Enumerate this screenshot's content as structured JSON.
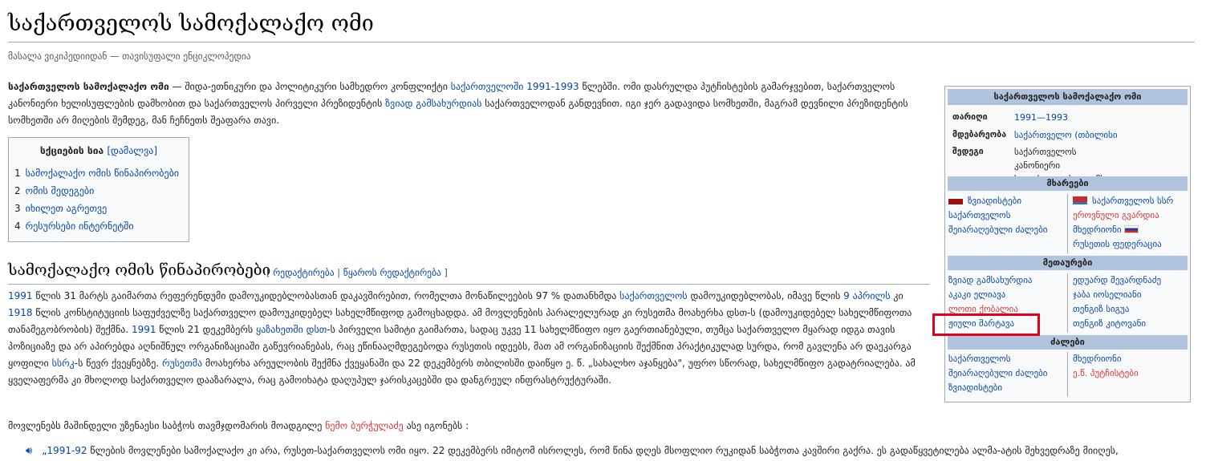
{
  "title": "საქართველოს სამოქალაქო ომი",
  "tagline": "მასალა ვიკიპედიიდან — თავისუფალი ენციკლოპედია",
  "intro": {
    "bold": "საქართველოს სამოქალაქო ომი",
    "t1": " — შიდა-ეთნიკური და პოლიტიკური სამხედრო კონფლიქტი ",
    "link1": "საქართველოში",
    "t2": " ",
    "link2": "1991-1993",
    "t3": " წლებში. ომი დასრულდა პუტჩისტების გამარჯვებით, საქართველოს კანონიერი ხელისუფლების დამხობით და საქართველოს პირველი პრეზიდენტის ",
    "link3": "ზვიად გამსახურდიას",
    "t4": " საქართველოდან განდევნით. იგი ჯერ გადავიდა სომხეთში, მაგრამ დევნილი პრეზიდენტის სომხეთში არ მიღების შემდეგ, მან ჩეჩნეთს შეაფარა თავი."
  },
  "toc": {
    "title": "სქციების სია",
    "toggle": "[დამალვა]",
    "items": [
      {
        "num": "1",
        "label": "სამოქალაქო ომის წინაპირობები"
      },
      {
        "num": "2",
        "label": "ომის შედეგები"
      },
      {
        "num": "3",
        "label": "იხილეთ აგრეთვე"
      },
      {
        "num": "4",
        "label": "რესურსები ინტერნეტში"
      }
    ]
  },
  "section1": {
    "heading": "სამოქალაქო ომის წინაპირობები",
    "edit_open": "[ ",
    "edit": "რედაქტირება",
    "sep": " | ",
    "edit_source": "წყაროს რედაქტირება",
    "edit_close": " ]",
    "p": {
      "l1": "1991",
      "t1": " წლის 31 მარტს გაიმართა რეფერენდუმი დამოუკიდებლობასთან დაკავშირებით, რომელთა მონაწილეების 97 % დათანხმდა ",
      "l2": "საქართველოს",
      "t2": " დამოუკიდებლობას, იმავე წლის ",
      "l3": "9 აპრილს",
      "t3": " კი ",
      "l4": "1918",
      "t4": " წლის კონსტიტუციის საფუძველზე საქართველო დამოუკიდებელ სახელმწიფოდ გამოცხადდა. ამ მოვლენების პარალელურად კი რუსეთმა მოახერხა დსთ-ს (დამოუკიდებელ სახელმწიფოთა თანამეგობრობის) შექმნა. ",
      "l5": "1991",
      "t5": " წლის 21 დეკემბერს ",
      "l6": "ყაზახეთში",
      "t6": " ",
      "l7": "დსთ",
      "t7": "-ს პირველი სამიტი გაიმართა, სადაც უკვე 11 სახელმწიფო იყო გაერთიანებული, თუმცა საქართველო მყარად იდგა თავის პოზიციაზე და არ აპირებდა აღნიშნულ ორგანიზაციაში გაწევრიანებას, რაც ეწინააღმდეგებოდა რუსეთის იდეებს, მათ ამ ორგანიზაციის შექმნით პრაქტიკულად სურდა, რომ გავლენა არ დაეკარგა ყოფილი ",
      "l8": "სსრკ",
      "t8": "-ს წევრ ქვეყნებზე. ",
      "l9": "რუსეთმა",
      "t9": " მოახერხა არეულობის შექმნა ქვეყანაში და 22 დეკემბერს თბილისში დაიწყო ე. წ. „სახალხო აჯანყება\", უფრო სწორად, სახელმწიფო გადატრიალება. ამ ყველაფერმა კი მხოლოდ საქართველო დააზარალა, რაც გამოიხატა დაღუპულ ჯარისკაცებში და დანგრეულ ინფრასტრუქტურაში."
    },
    "quote_intro": {
      "t1": "მოვლენებს მაშინდელი უზენაესი საბჭოს თავმჯდომარის მოადგილე ",
      "link": "ნემო ბურჭულაძე",
      "t2": " ასე იგონებს :"
    },
    "quote": {
      "t1": "„",
      "link": "1991-92",
      "t2": " წლების მოვლენები სამოქალაქო კი არა, რუსეთ-საქართველოს ომი იყო. 22 დეკემბერს იმიტომ ისროლეს, რომ წინა დღეს მსოფლიო რუკიდან საბჭოთა კავშირი გაქრა. ეს გადაწყვეტილება ალმა-ატის შეხვედრაზე მიიღეს,"
    }
  },
  "infobox": {
    "title": "საქართველოს სამოქალაქო ომი",
    "rows": [
      {
        "label": "თარიღი",
        "value": "1991—1993"
      },
      {
        "label": "მდებარეობა",
        "value": "საქართველო (თბილისი"
      },
      {
        "label": "შედეგი",
        "value": "საქართველოს კანონიერი ხელისუფლება დაემხო"
      }
    ],
    "sides_header": "მხარეები",
    "left_side": [
      "ზვიადისტები",
      "საქართველოს",
      "შეიარაღებული ძალები"
    ],
    "right_side": [
      "საქართველოს სსრ",
      "ეროვნული გვარდია",
      "მხედრიონი",
      "რუსეთის ფედერაცია"
    ],
    "commanders_header": "მეთაურები",
    "left_commanders": [
      "ზვიად გამსახურდია",
      "აკაკი ელიავა",
      "ლოთი ქობალია",
      "ჟიული შარტავა"
    ],
    "right_commanders": [
      "ედუარდ შევარდნაძე",
      "ჯაბა იოსელიანი",
      "თენგიზ სიგუა",
      "თენგიზ კიტოვანი"
    ],
    "forces_header": "ძალები",
    "left_forces": [
      "საქართველოს",
      "შეიარაღებული ძალები",
      "ზვიადისტები"
    ],
    "right_forces": [
      "მხედრიონი",
      "ე.წ. პუტჩისტები"
    ]
  },
  "colors": {
    "link": "#0645ad",
    "redlink": "#d33",
    "highlight": "#e0001b",
    "infobox_header": "#b0c4de"
  },
  "icons": {
    "speaker": "speaker-icon"
  }
}
